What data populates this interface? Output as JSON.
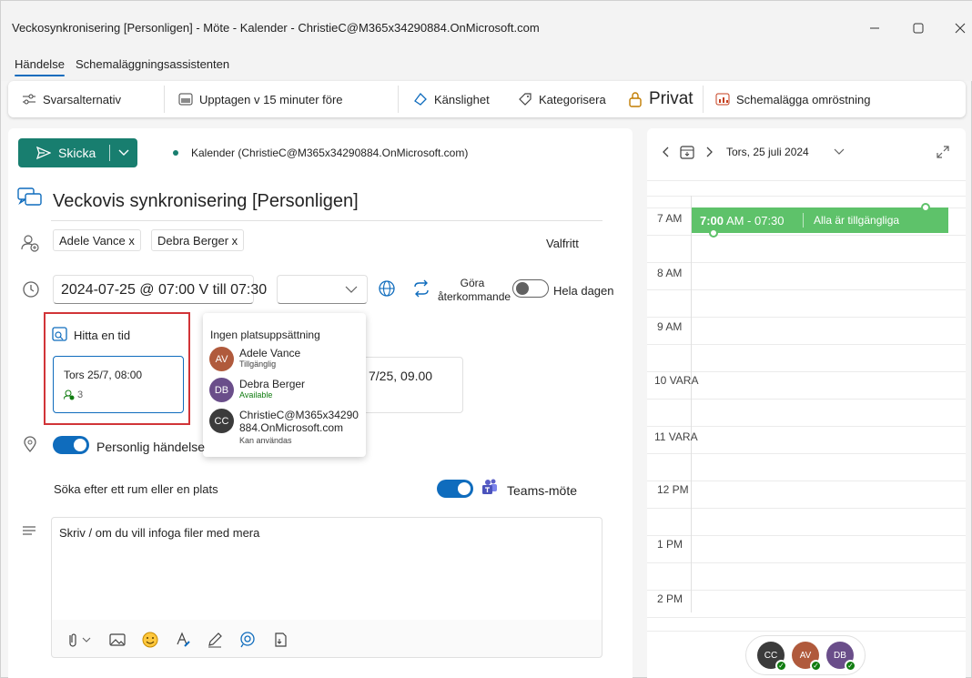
{
  "window": {
    "title": "Veckosynkronisering [Personligen] - Möte - Kalender - ChristieC@M365x34290884.OnMicrosoft.com",
    "controls": [
      "minimize",
      "maximize",
      "close"
    ]
  },
  "ribbon": {
    "tabs": [
      {
        "label": "Händelse",
        "active": true
      },
      {
        "label": "Schemaläggningsassistenten",
        "active": false
      }
    ],
    "toolbar": {
      "response_options": "Svarsalternativ",
      "busy_reminder": "Upptagen v 15 minuter före",
      "sensitivity": "Känslighet",
      "categorize": "Kategorisera",
      "private": "Privat",
      "schedule_poll": "Schemalägga omröstning"
    }
  },
  "form": {
    "send_label": "Skicka",
    "calendar": "Kalender (ChristieC@M365x34290884.OnMicrosoft.com)",
    "subject": "Veckovis synkronisering [Personligen]",
    "attendees": [
      "Adele Vance x",
      "Debra Berger x"
    ],
    "optional_label": "Valfritt",
    "datetime": "2024-07-25 @ 07:00 V till 07:30",
    "recurring_line1": "Göra",
    "recurring_line2": "återkommande",
    "all_day_label": "Hela dagen",
    "all_day_on": false,
    "find_time_label": "Hitta en tid",
    "suggestion": {
      "time": "Tors 25/7, 08:00",
      "count": "3"
    },
    "suggestion2_time": "7/25, 09.00",
    "personal_event_label": "Personlig händelse",
    "personal_event_on": true,
    "room_search_label": "Söka efter ett rum eller en plats",
    "teams_label": "Teams-möte",
    "teams_on": true,
    "body_placeholder": "Skriv / om du vill infoga filer med mera"
  },
  "popup": {
    "header": "Ingen platsuppsättning",
    "people": [
      {
        "name": "Adele Vance",
        "status": "Tillgänglig",
        "color": "#b05a3c",
        "status_color": "#424242"
      },
      {
        "name": "Debra Berger",
        "status": "Available",
        "color": "#6a4e8a",
        "status_color": "#107c10"
      },
      {
        "name_line1": "ChristieC@M365x34290",
        "name_line2": "884.OnMicrosoft.com",
        "status": "Kan användas",
        "color": "#3b3b3b"
      }
    ]
  },
  "calendar": {
    "date": "Tors, 25 juli 2024",
    "hours": [
      "7 AM",
      "8 AM",
      "9 AM",
      "10 VARA",
      "11 VARA",
      "12 PM",
      "1 PM",
      "2 PM"
    ],
    "event": {
      "start_bold": "7:00",
      "time_rest": "AM - 07:30",
      "title": "Alla är tillgängliga",
      "color": "#5ec26a"
    }
  },
  "colors": {
    "accent": "#0f6cbd",
    "send": "#187e6f",
    "highlight": "#d13438"
  }
}
